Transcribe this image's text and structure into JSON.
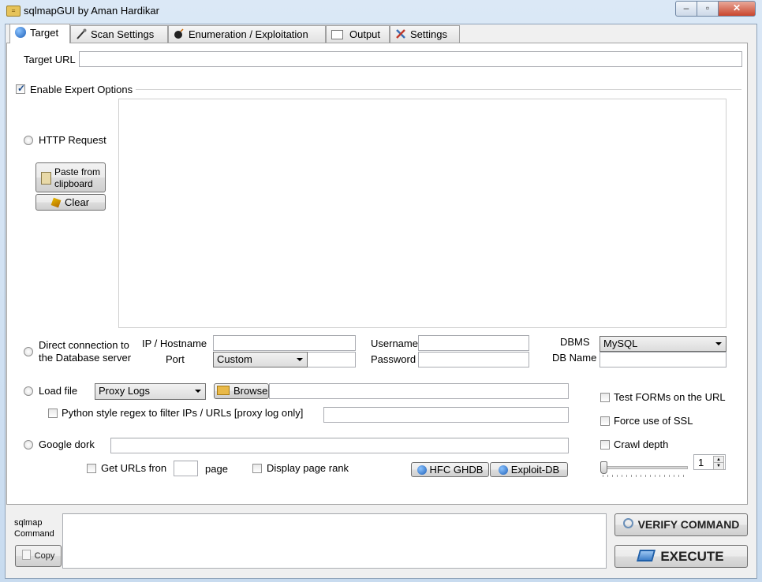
{
  "window": {
    "title": "sqlmapGUI by Aman Hardikar",
    "icon_text": "="
  },
  "title_controls": {
    "minimize": "–",
    "maximize": "▫",
    "close": "✕"
  },
  "tabs": [
    {
      "label": "Target",
      "icon": "globe-icon",
      "active": true
    },
    {
      "label": "Scan Settings",
      "icon": "wand-icon"
    },
    {
      "label": "Enumeration / Exploitation",
      "icon": "bomb-icon"
    },
    {
      "label": "Output",
      "icon": "window-icon"
    },
    {
      "label": "Settings",
      "icon": "tools-icon"
    }
  ],
  "target": {
    "url_label": "Target URL",
    "url_value": "",
    "expert_label": "Enable Expert Options",
    "expert_checked": true
  },
  "http_request": {
    "label": "HTTP Request",
    "paste_label_line1": "Paste from",
    "paste_label_line2": "clipboard",
    "clear_label": "Clear",
    "body": ""
  },
  "direct": {
    "label_line1": "Direct connection to",
    "label_line2": "the Database server",
    "ip_label": "IP / Hostname",
    "port_label": "Port",
    "port_option": "Custom",
    "username_label": "Username",
    "password_label": "Password",
    "dbms_label": "DBMS",
    "dbms_value": "MySQL",
    "dbname_label": "DB Name"
  },
  "load_file": {
    "label": "Load file",
    "type_value": "Proxy Logs",
    "browse_label": "Browse",
    "regex_label": "Python style regex to filter IPs / URLs [proxy log only]"
  },
  "options": {
    "test_forms": "Test FORMs on the URL",
    "force_ssl": "Force use of SSL",
    "crawl_depth": "Crawl depth",
    "crawl_value": "1"
  },
  "google": {
    "label": "Google dork",
    "get_urls_label": "Get URLs fron",
    "page_label": "page",
    "page_rank_label": "Display page rank",
    "hfc_label": "HFC GHDB",
    "exploitdb_label": "Exploit-DB"
  },
  "command": {
    "label_line1": "sqlmap",
    "label_line2": "Command",
    "copy_label": "Copy",
    "verify_label": "VERIFY COMMAND",
    "execute_label": "EXECUTE"
  }
}
